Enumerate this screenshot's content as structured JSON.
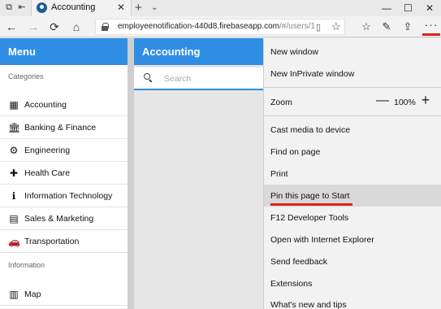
{
  "tab": {
    "title": "Accounting",
    "close": "✕"
  },
  "tabbar": {
    "new_tab": "+",
    "tab_menu": "⌄",
    "minimize": "—",
    "maximize": "☐",
    "close": "✕"
  },
  "nav": {
    "back": "←",
    "forward": "→",
    "refresh": "⟳",
    "home": "⌂",
    "url_host": "employeenotification-440d8.firebaseapp.com",
    "url_rest": "/#/users/1",
    "more": "···"
  },
  "sidebar": {
    "title": "Menu",
    "categories_label": "Categories",
    "information_label": "Information",
    "categories": [
      {
        "label": "Accounting",
        "icon": "calculator-icon",
        "glyph": "▦"
      },
      {
        "label": "Banking & Finance",
        "icon": "bank-icon",
        "glyph": "🏛"
      },
      {
        "label": "Engineering",
        "icon": "gear-icon",
        "glyph": "⚙"
      },
      {
        "label": "Health Care",
        "icon": "medkit-icon",
        "glyph": "✚"
      },
      {
        "label": "Information Technology",
        "icon": "info-icon",
        "glyph": "ℹ"
      },
      {
        "label": "Sales & Marketing",
        "icon": "money-icon",
        "glyph": "▤"
      },
      {
        "label": "Transportation",
        "icon": "car-icon",
        "glyph": "🚗"
      }
    ],
    "information": [
      {
        "label": "Map",
        "icon": "map-icon",
        "glyph": "▥"
      }
    ]
  },
  "main": {
    "title": "Accounting",
    "search_placeholder": "Search"
  },
  "menu": {
    "new_window": "New window",
    "new_inprivate": "New InPrivate window",
    "zoom_label": "Zoom",
    "zoom_minus": "—",
    "zoom_value": "100%",
    "zoom_plus": "+",
    "cast": "Cast media to device",
    "find": "Find on page",
    "print": "Print",
    "pin": "Pin this page to Start",
    "f12": "F12 Developer Tools",
    "open_ie": "Open with Internet Explorer",
    "feedback": "Send feedback",
    "extensions": "Extensions",
    "whats_new": "What's new and tips"
  },
  "colors": {
    "accent": "#2f8ee4",
    "annotation": "#e0201b",
    "highlight": "#d9d9d9"
  }
}
